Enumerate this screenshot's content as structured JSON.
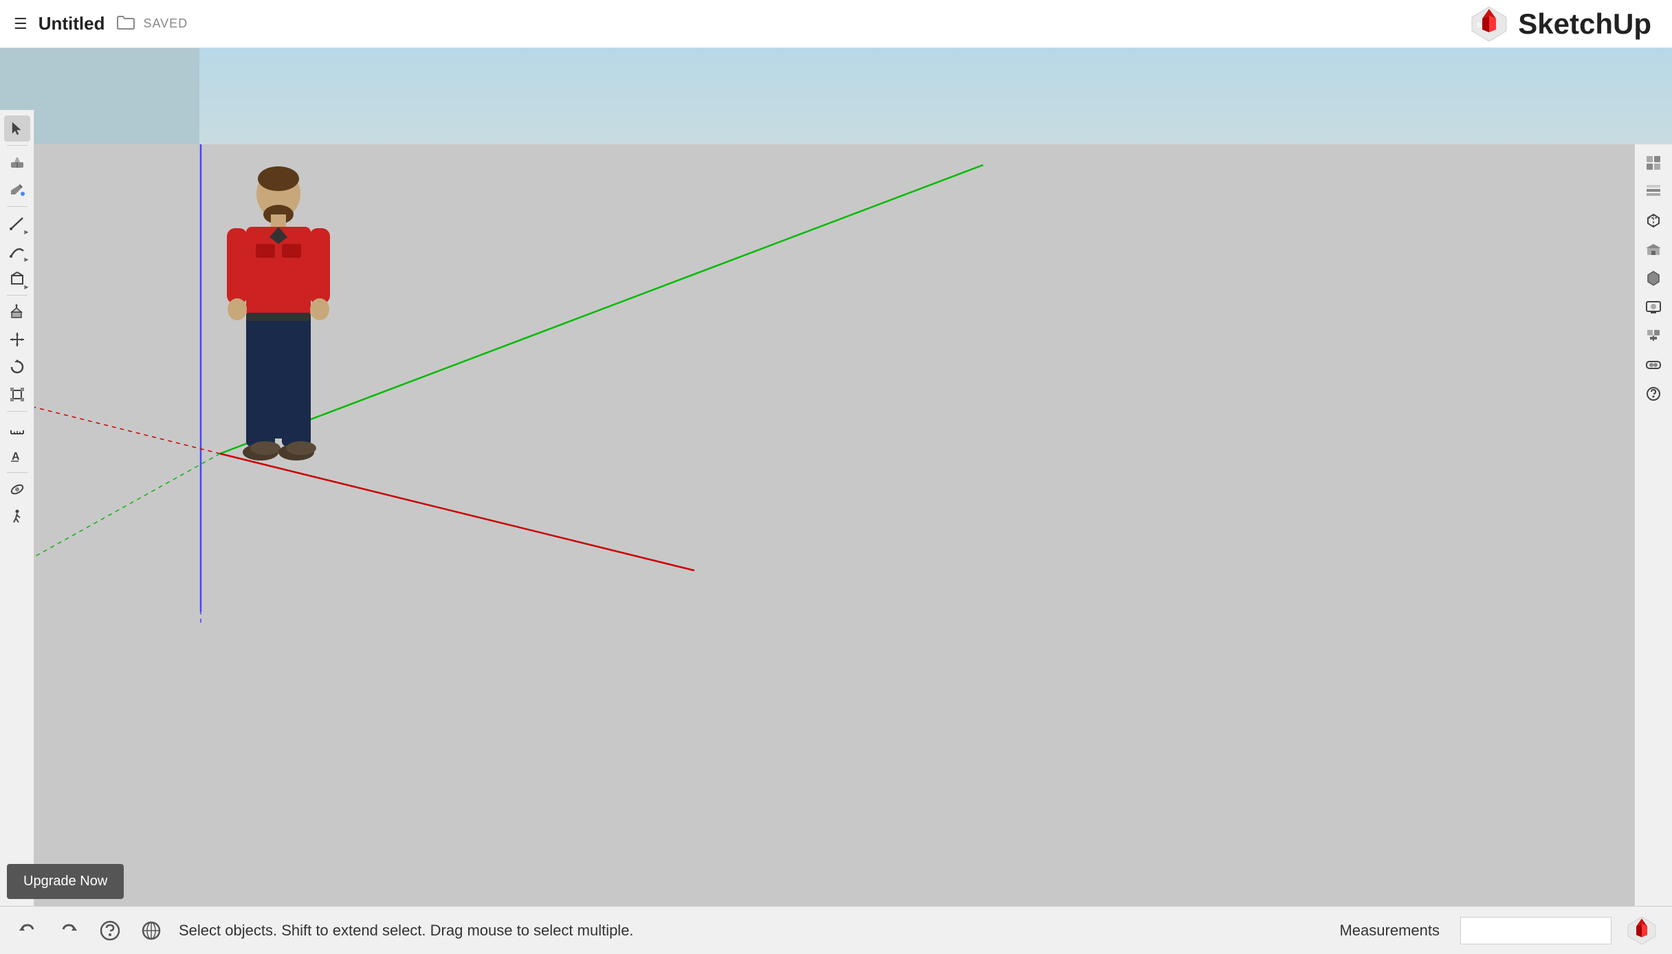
{
  "header": {
    "hamburger": "☰",
    "title": "Untitled",
    "folder_icon": "🗀",
    "saved_label": "SAVED",
    "logo_text": "SketchUp"
  },
  "left_toolbar": {
    "tools": [
      {
        "name": "select",
        "icon": "cursor",
        "has_arrow": false
      },
      {
        "name": "eraser",
        "icon": "eraser",
        "has_arrow": false
      },
      {
        "name": "paint-bucket",
        "icon": "paint",
        "has_arrow": false
      },
      {
        "name": "line",
        "icon": "line",
        "has_arrow": true
      },
      {
        "name": "arc",
        "icon": "arc",
        "has_arrow": true
      },
      {
        "name": "shape",
        "icon": "shape",
        "has_arrow": true
      },
      {
        "name": "push-pull",
        "icon": "pushpull",
        "has_arrow": false
      },
      {
        "name": "move",
        "icon": "move",
        "has_arrow": false
      },
      {
        "name": "rotate",
        "icon": "rotate",
        "has_arrow": false
      },
      {
        "name": "scale",
        "icon": "scale",
        "has_arrow": false
      },
      {
        "name": "tape-measure",
        "icon": "tape",
        "has_arrow": false
      },
      {
        "name": "text",
        "icon": "text",
        "has_arrow": false
      },
      {
        "name": "orbit",
        "icon": "orbit",
        "has_arrow": false
      },
      {
        "name": "walk",
        "icon": "walk",
        "has_arrow": false
      }
    ]
  },
  "right_toolbar": {
    "tools": [
      {
        "name": "styles",
        "icon": "styles"
      },
      {
        "name": "layers",
        "icon": "layers"
      },
      {
        "name": "components",
        "icon": "components"
      },
      {
        "name": "3d-warehouse",
        "icon": "warehouse"
      },
      {
        "name": "solid-tools",
        "icon": "solid"
      },
      {
        "name": "scenes",
        "icon": "scenes"
      },
      {
        "name": "extension-manager",
        "icon": "extension"
      },
      {
        "name": "vr",
        "icon": "vr"
      },
      {
        "name": "unknown",
        "icon": "unknown"
      }
    ]
  },
  "bottom_bar": {
    "undo_label": "↺",
    "redo_label": "↻",
    "help_label": "?",
    "geo_label": "⊕",
    "status_text": "Select objects. Shift to extend select. Drag mouse to select multiple.",
    "measurements_label": "Measurements",
    "sketchup_icon": "S"
  },
  "upgrade_button": {
    "label": "Upgrade Now"
  },
  "viewport": {
    "axis_colors": {
      "green": "#00cc00",
      "red": "#cc0000",
      "blue": "#0000cc"
    }
  }
}
